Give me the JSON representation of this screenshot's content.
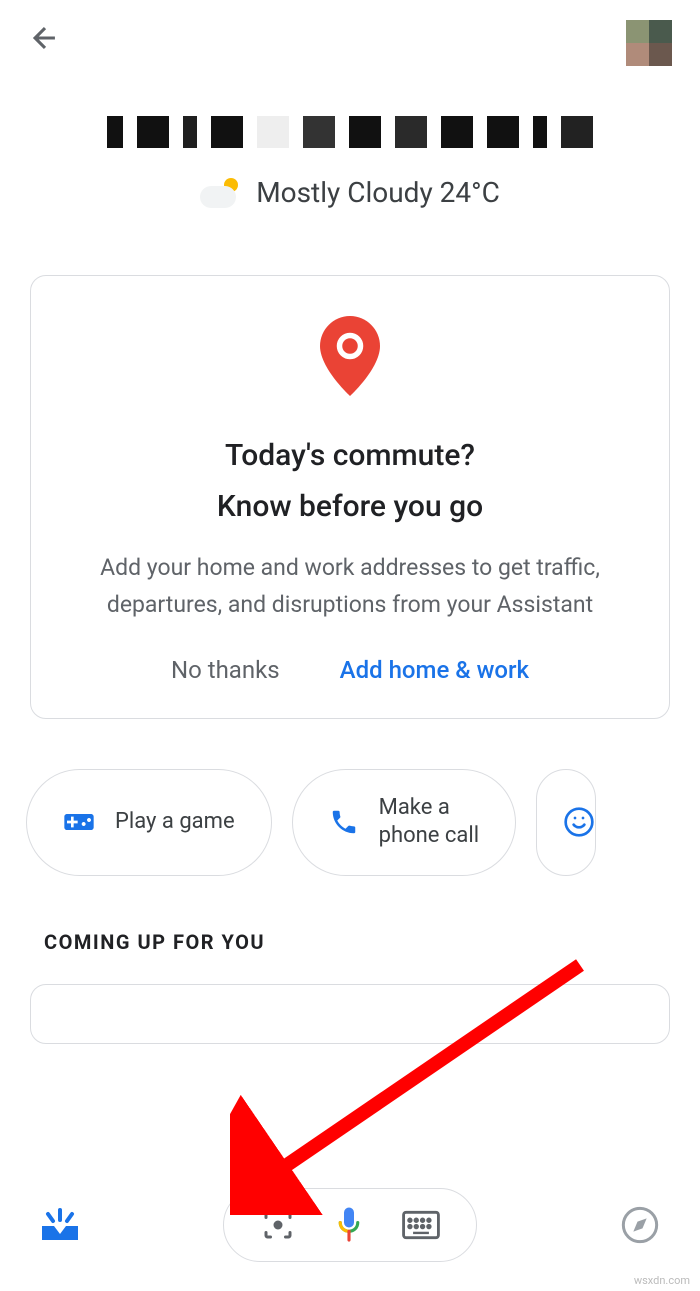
{
  "weather": {
    "text": "Mostly Cloudy 24°C"
  },
  "card": {
    "title_line1": "Today's commute?",
    "title_line2": "Know before you go",
    "body": "Add your home and work addresses to get traffic, departures, and disruptions from your Assistant",
    "no_thanks": "No thanks",
    "add": "Add home & work"
  },
  "chips": {
    "game": "Play a game",
    "call": "Make a\nphone call"
  },
  "section": {
    "coming_up": "COMING UP FOR YOU"
  },
  "watermark": "wsxdn.com"
}
